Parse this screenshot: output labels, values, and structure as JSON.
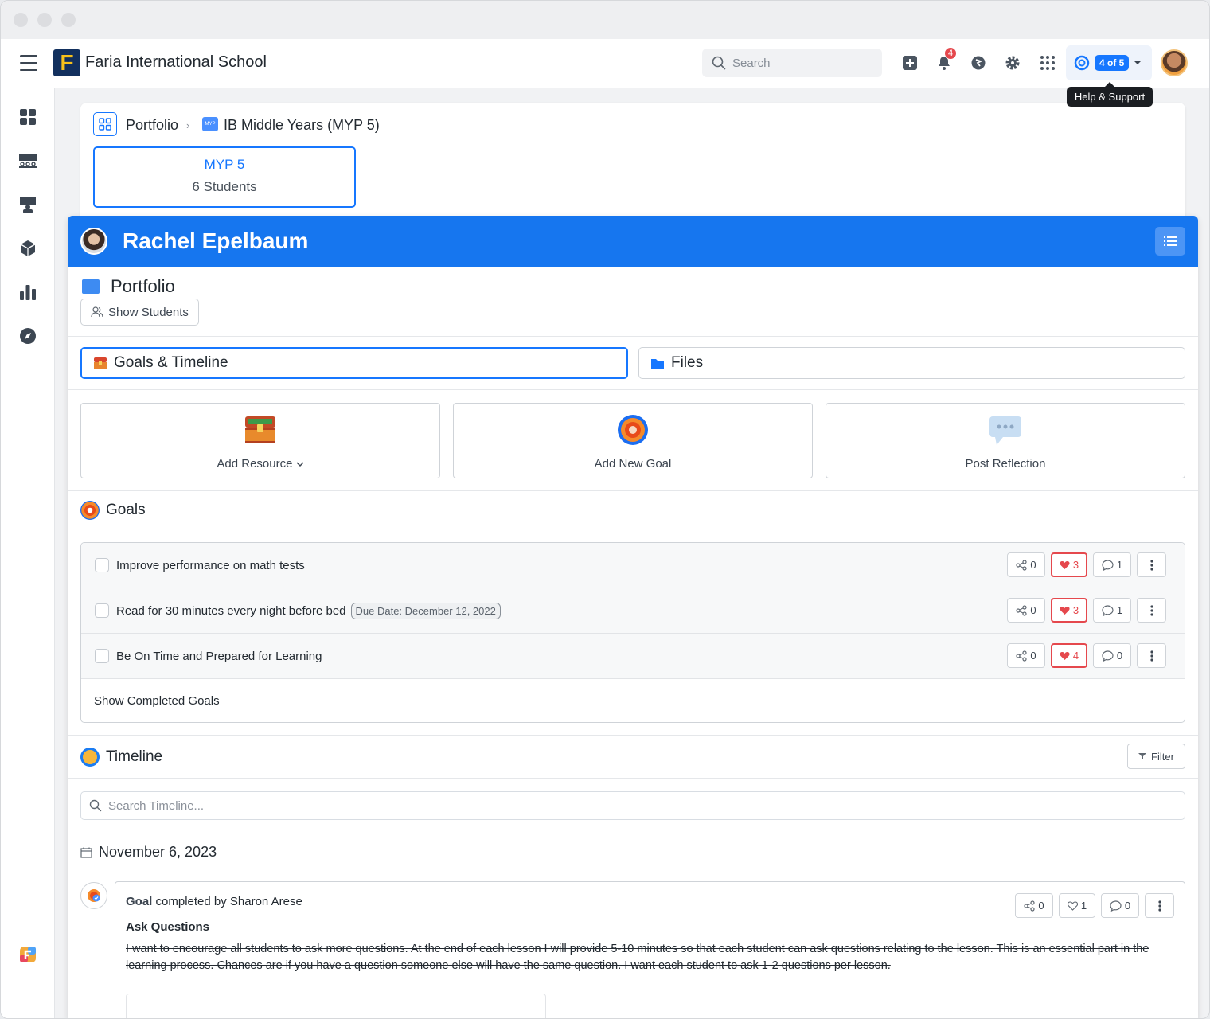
{
  "app": {
    "school_name": "Faria International School",
    "logo_letter": "F",
    "search_placeholder": "Search",
    "notifications_count": "4",
    "help_counter": "4 of 5",
    "help_tooltip": "Help & Support"
  },
  "breadcrumb": {
    "root": "Portfolio",
    "current": "IB Middle Years (MYP 5)",
    "myp_icon_text": "MYP"
  },
  "class_card": {
    "name": "MYP 5",
    "count": "6 Students"
  },
  "student": {
    "name": "Rachel Epelbaum"
  },
  "portfolio": {
    "title": "Portfolio",
    "show_students": "Show Students"
  },
  "tabs": [
    {
      "label": "Goals & Timeline",
      "active": true
    },
    {
      "label": "Files",
      "active": false
    }
  ],
  "actions": [
    {
      "label": "Add Resource",
      "icon": "treasure-chest-icon"
    },
    {
      "label": "Add New Goal",
      "icon": "target-icon"
    },
    {
      "label": "Post Reflection",
      "icon": "speech-bubble-icon"
    }
  ],
  "goals": {
    "title": "Goals",
    "items": [
      {
        "text": "Improve performance on math tests",
        "due": "",
        "shares": "0",
        "likes": "3",
        "comments": "1"
      },
      {
        "text": "Read for 30 minutes every night before bed",
        "due": "Due Date: December 12, 2022",
        "shares": "0",
        "likes": "3",
        "comments": "1"
      },
      {
        "text": "Be On Time and Prepared for Learning",
        "due": "",
        "shares": "0",
        "likes": "4",
        "comments": "0"
      }
    ],
    "show_completed": "Show Completed Goals"
  },
  "timeline": {
    "title": "Timeline",
    "filter_label": "Filter",
    "search_placeholder": "Search Timeline...",
    "date": "November 6, 2023",
    "post": {
      "type": "Goal",
      "meta_rest": "completed by Sharon Arese",
      "title": "Ask Questions",
      "body": "I want to encourage all students to ask more questions. At the end of each lesson I will provide 5-10 minutes so that each student can ask questions relating to the lesson. This is an essential part in the learning process. Chances are if you have a question someone else will have the same question. I want each student to ask 1-2 questions per lesson.",
      "shares": "0",
      "likes": "1",
      "comments": "0"
    }
  },
  "colors": {
    "accent": "#1677ff",
    "header_blue": "#1676ef",
    "like_red": "#e5484d"
  }
}
